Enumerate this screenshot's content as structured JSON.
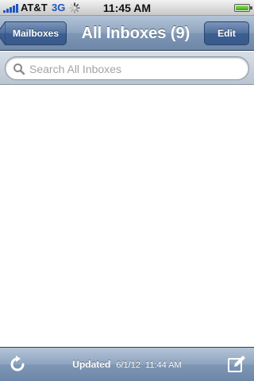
{
  "status_bar": {
    "carrier": "AT&T",
    "network": "3G",
    "time": "11:45 AM",
    "signal_icon": "signal-bars-icon",
    "activity_icon": "activity-spinner-icon",
    "battery_icon": "battery-icon"
  },
  "nav_bar": {
    "back_label": "Mailboxes",
    "title": "All Inboxes (9)",
    "edit_label": "Edit"
  },
  "search": {
    "placeholder": "Search All Inboxes",
    "icon": "search-icon"
  },
  "toolbar": {
    "updated_label": "Updated",
    "updated_date": "6/1/12",
    "updated_time": "11:44 AM",
    "refresh_icon": "refresh-icon",
    "compose_icon": "compose-icon"
  },
  "colors": {
    "nav_bar": "#8ea4bf",
    "button": "#4f6e9c",
    "network_blue": "#1e56c2",
    "placeholder_gray": "#a3a3a3"
  }
}
